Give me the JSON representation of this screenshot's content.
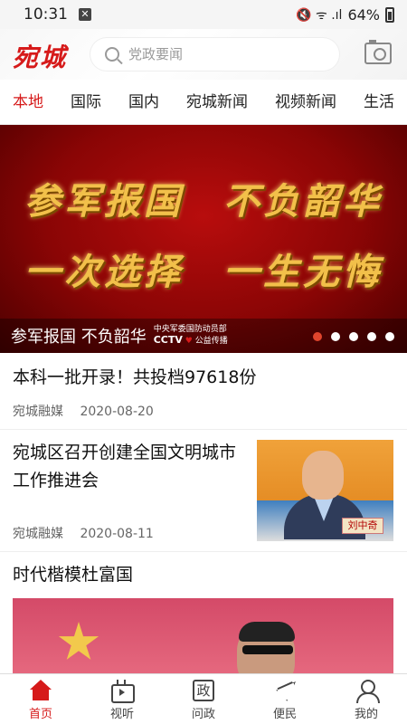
{
  "status_bar": {
    "time": "10:31",
    "notification_glyph": "✕",
    "signal": "🔇 ᯤ .ıl",
    "battery": "64%"
  },
  "header": {
    "logo": "宛城",
    "search_placeholder": "党政要闻",
    "icons": {
      "search": "search-icon",
      "camera": "camera-icon"
    }
  },
  "tabs": [
    {
      "label": "本地",
      "active": true
    },
    {
      "label": "国际"
    },
    {
      "label": "国内"
    },
    {
      "label": "宛城新闻"
    },
    {
      "label": "视频新闻"
    },
    {
      "label": "生活"
    }
  ],
  "banner": {
    "line1": "参军报国　不负韶华",
    "line2": "一次选择　一生无悔",
    "caption": "参军报国 不负韶华",
    "credit_line1": "中央军委国防动员部",
    "credit_cctv": "CCTV",
    "credit_heart": "♥",
    "credit_line2": "公益传播",
    "slide_count": 5,
    "active_slide": 1
  },
  "news": [
    {
      "title": "本科一批开录！共投档97618份",
      "source": "宛城融媒",
      "date": "2020-08-20"
    },
    {
      "title": "宛城区召开创建全国文明城市工作推进会",
      "source": "宛城融媒",
      "date": "2020-08-11",
      "thumbnail_label": "刘中奇"
    },
    {
      "title": "时代楷模杜富国"
    }
  ],
  "bottom_nav": [
    {
      "label": "首页",
      "icon": "home-icon",
      "active": true
    },
    {
      "label": "视听",
      "icon": "tv-icon"
    },
    {
      "label": "问政",
      "icon": "ask-icon",
      "glyph": "政"
    },
    {
      "label": "便民",
      "icon": "send-icon"
    },
    {
      "label": "我的",
      "icon": "user-icon"
    }
  ],
  "colors": {
    "accent": "#d61a1a",
    "banner_text": "#f2c04a",
    "active_dot": "#e0452d"
  }
}
